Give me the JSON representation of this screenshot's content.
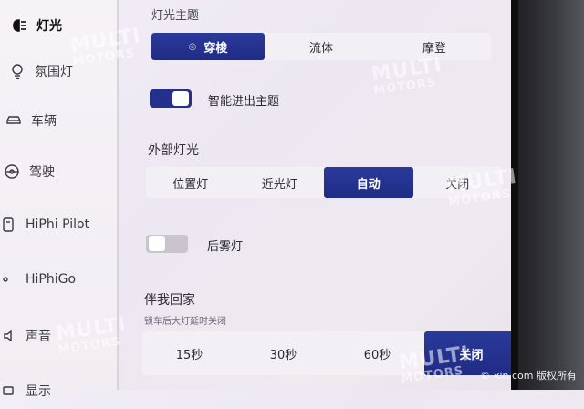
{
  "sidebar": {
    "items": [
      {
        "label": "灯光",
        "icon": "headlight-icon",
        "active": true
      },
      {
        "label": "氛围灯",
        "icon": "ambient-light-icon",
        "active": false
      },
      {
        "label": "车辆",
        "icon": "car-icon",
        "active": false
      },
      {
        "label": "驾驶",
        "icon": "steering-wheel-icon",
        "active": false
      },
      {
        "label": "HiPhi Pilot",
        "icon": "pilot-icon",
        "active": false
      },
      {
        "label": "HiPhiGo",
        "icon": "hiphigo-icon",
        "active": false
      },
      {
        "label": "声音",
        "icon": "sound-icon",
        "active": false
      },
      {
        "label": "显示",
        "icon": "display-icon",
        "active": false
      }
    ]
  },
  "light_theme": {
    "title": "灯光主题",
    "options": [
      "穿梭",
      "流体",
      "摩登"
    ],
    "selected": "穿梭"
  },
  "smart_theme": {
    "label": "智能进出主题",
    "on": true
  },
  "exterior": {
    "title": "外部灯光",
    "options": [
      "位置灯",
      "近光灯",
      "自动",
      "关闭"
    ],
    "selected": "自动"
  },
  "rear_fog": {
    "label": "后雾灯",
    "on": false
  },
  "follow_home": {
    "title": "伴我回家",
    "subtitle": "锁车后大灯延时关闭",
    "options": [
      "15秒",
      "30秒",
      "60秒",
      "关闭"
    ],
    "selected": "关闭"
  },
  "watermark": {
    "brand": "MULTI",
    "brand2": "MOTORS",
    "credit": "xin.com 版权所有"
  },
  "colors": {
    "accent": "#23318c",
    "background": "#efeaf2"
  }
}
